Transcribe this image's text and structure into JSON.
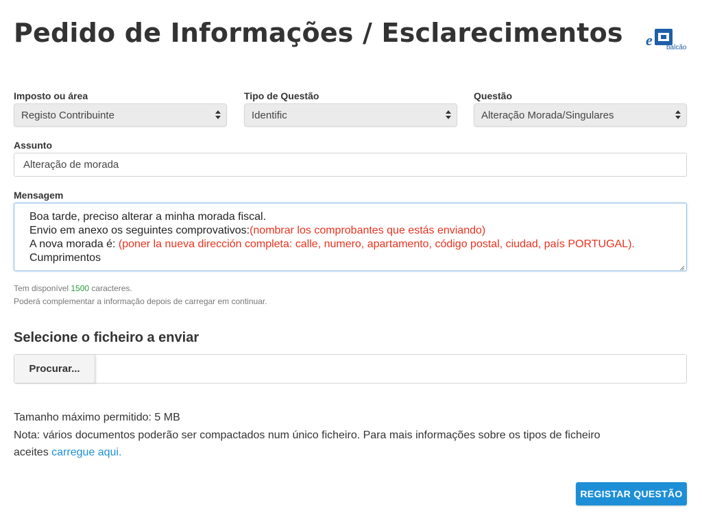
{
  "page": {
    "title": "Pedido de Informações / Esclarecimentos"
  },
  "logo": {
    "letter": "e",
    "text": "balcão"
  },
  "form": {
    "imposto": {
      "label": "Imposto ou área",
      "value": "Registo Contribuinte"
    },
    "tipo": {
      "label": "Tipo de Questão",
      "value": "Identific"
    },
    "questao": {
      "label": "Questão",
      "value": "Alteração Morada/Singulares"
    },
    "assunto": {
      "label": "Assunto",
      "value": "Alteração de morada"
    },
    "mensagem": {
      "label": "Mensagem",
      "line1": "Boa tarde, preciso alterar a minha morada fiscal.",
      "line2": "Envio em anexo os seguintes comprovativos:",
      "line2_note": "(nombrar los comprobantes que estás enviando)",
      "line3": "A nova morada é: ",
      "line3_note": "(poner la nueva dirección completa: calle, numero, apartamento, código postal, ciudad, país PORTUGAL).",
      "line4": "Cumprimentos"
    },
    "hint1_prefix": "Tem disponível ",
    "hint1_count": "1500",
    "hint1_suffix": " caracteres.",
    "hint2": "Poderá complementar a informação depois de carregar em continuar."
  },
  "upload": {
    "title": "Selecione o ficheiro a enviar",
    "browse_label": "Procurar...",
    "max_size": "Tamanho máximo permitido: 5 MB",
    "note_text": "Nota: vários documentos poderão ser compactados num único ficheiro. Para mais informações sobre os tipos de ficheiro",
    "note_text2": "aceites ",
    "note_link": "carregue aqui."
  },
  "actions": {
    "submit_label": "REGISTAR QUESTÃO"
  },
  "colors": {
    "accent": "#1e8fd6",
    "note_red": "#e8331f",
    "count_green": "#2a9a3a"
  }
}
